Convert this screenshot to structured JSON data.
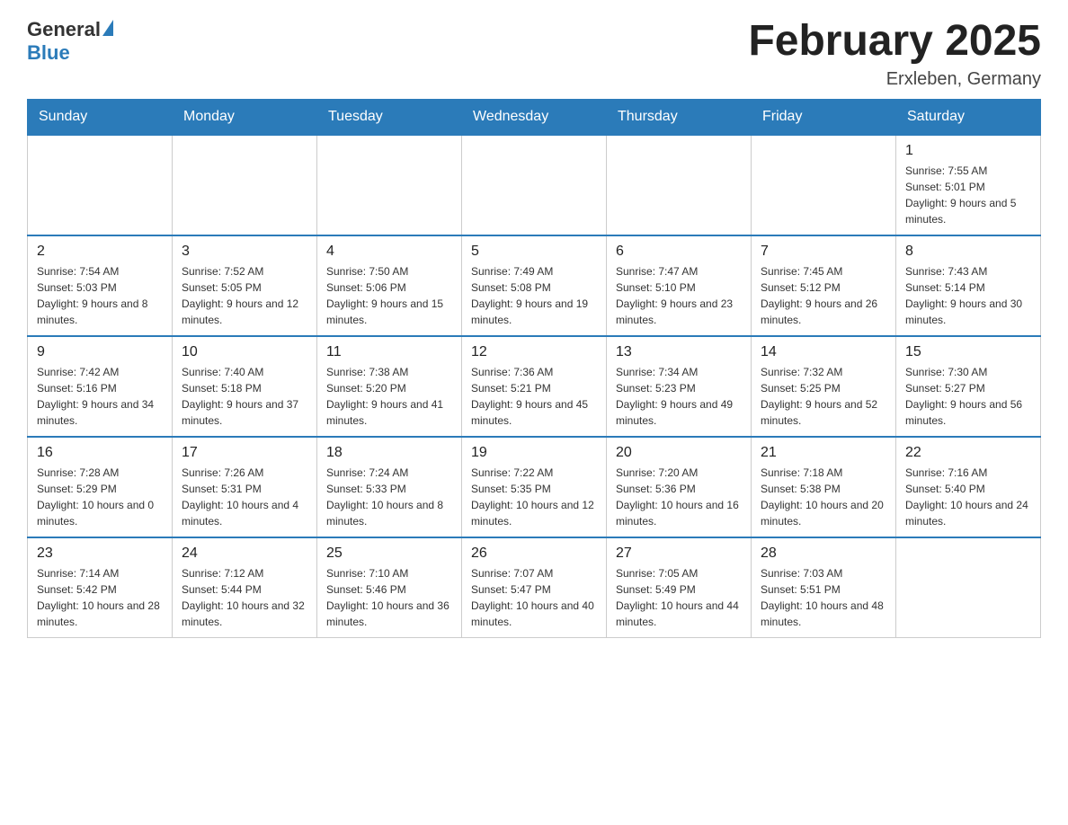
{
  "header": {
    "logo": {
      "general": "General",
      "blue": "Blue"
    },
    "title": "February 2025",
    "location": "Erxleben, Germany"
  },
  "weekdays": [
    "Sunday",
    "Monday",
    "Tuesday",
    "Wednesday",
    "Thursday",
    "Friday",
    "Saturday"
  ],
  "weeks": [
    [
      {
        "day": "",
        "info": ""
      },
      {
        "day": "",
        "info": ""
      },
      {
        "day": "",
        "info": ""
      },
      {
        "day": "",
        "info": ""
      },
      {
        "day": "",
        "info": ""
      },
      {
        "day": "",
        "info": ""
      },
      {
        "day": "1",
        "info": "Sunrise: 7:55 AM\nSunset: 5:01 PM\nDaylight: 9 hours and 5 minutes."
      }
    ],
    [
      {
        "day": "2",
        "info": "Sunrise: 7:54 AM\nSunset: 5:03 PM\nDaylight: 9 hours and 8 minutes."
      },
      {
        "day": "3",
        "info": "Sunrise: 7:52 AM\nSunset: 5:05 PM\nDaylight: 9 hours and 12 minutes."
      },
      {
        "day": "4",
        "info": "Sunrise: 7:50 AM\nSunset: 5:06 PM\nDaylight: 9 hours and 15 minutes."
      },
      {
        "day": "5",
        "info": "Sunrise: 7:49 AM\nSunset: 5:08 PM\nDaylight: 9 hours and 19 minutes."
      },
      {
        "day": "6",
        "info": "Sunrise: 7:47 AM\nSunset: 5:10 PM\nDaylight: 9 hours and 23 minutes."
      },
      {
        "day": "7",
        "info": "Sunrise: 7:45 AM\nSunset: 5:12 PM\nDaylight: 9 hours and 26 minutes."
      },
      {
        "day": "8",
        "info": "Sunrise: 7:43 AM\nSunset: 5:14 PM\nDaylight: 9 hours and 30 minutes."
      }
    ],
    [
      {
        "day": "9",
        "info": "Sunrise: 7:42 AM\nSunset: 5:16 PM\nDaylight: 9 hours and 34 minutes."
      },
      {
        "day": "10",
        "info": "Sunrise: 7:40 AM\nSunset: 5:18 PM\nDaylight: 9 hours and 37 minutes."
      },
      {
        "day": "11",
        "info": "Sunrise: 7:38 AM\nSunset: 5:20 PM\nDaylight: 9 hours and 41 minutes."
      },
      {
        "day": "12",
        "info": "Sunrise: 7:36 AM\nSunset: 5:21 PM\nDaylight: 9 hours and 45 minutes."
      },
      {
        "day": "13",
        "info": "Sunrise: 7:34 AM\nSunset: 5:23 PM\nDaylight: 9 hours and 49 minutes."
      },
      {
        "day": "14",
        "info": "Sunrise: 7:32 AM\nSunset: 5:25 PM\nDaylight: 9 hours and 52 minutes."
      },
      {
        "day": "15",
        "info": "Sunrise: 7:30 AM\nSunset: 5:27 PM\nDaylight: 9 hours and 56 minutes."
      }
    ],
    [
      {
        "day": "16",
        "info": "Sunrise: 7:28 AM\nSunset: 5:29 PM\nDaylight: 10 hours and 0 minutes."
      },
      {
        "day": "17",
        "info": "Sunrise: 7:26 AM\nSunset: 5:31 PM\nDaylight: 10 hours and 4 minutes."
      },
      {
        "day": "18",
        "info": "Sunrise: 7:24 AM\nSunset: 5:33 PM\nDaylight: 10 hours and 8 minutes."
      },
      {
        "day": "19",
        "info": "Sunrise: 7:22 AM\nSunset: 5:35 PM\nDaylight: 10 hours and 12 minutes."
      },
      {
        "day": "20",
        "info": "Sunrise: 7:20 AM\nSunset: 5:36 PM\nDaylight: 10 hours and 16 minutes."
      },
      {
        "day": "21",
        "info": "Sunrise: 7:18 AM\nSunset: 5:38 PM\nDaylight: 10 hours and 20 minutes."
      },
      {
        "day": "22",
        "info": "Sunrise: 7:16 AM\nSunset: 5:40 PM\nDaylight: 10 hours and 24 minutes."
      }
    ],
    [
      {
        "day": "23",
        "info": "Sunrise: 7:14 AM\nSunset: 5:42 PM\nDaylight: 10 hours and 28 minutes."
      },
      {
        "day": "24",
        "info": "Sunrise: 7:12 AM\nSunset: 5:44 PM\nDaylight: 10 hours and 32 minutes."
      },
      {
        "day": "25",
        "info": "Sunrise: 7:10 AM\nSunset: 5:46 PM\nDaylight: 10 hours and 36 minutes."
      },
      {
        "day": "26",
        "info": "Sunrise: 7:07 AM\nSunset: 5:47 PM\nDaylight: 10 hours and 40 minutes."
      },
      {
        "day": "27",
        "info": "Sunrise: 7:05 AM\nSunset: 5:49 PM\nDaylight: 10 hours and 44 minutes."
      },
      {
        "day": "28",
        "info": "Sunrise: 7:03 AM\nSunset: 5:51 PM\nDaylight: 10 hours and 48 minutes."
      },
      {
        "day": "",
        "info": ""
      }
    ]
  ]
}
